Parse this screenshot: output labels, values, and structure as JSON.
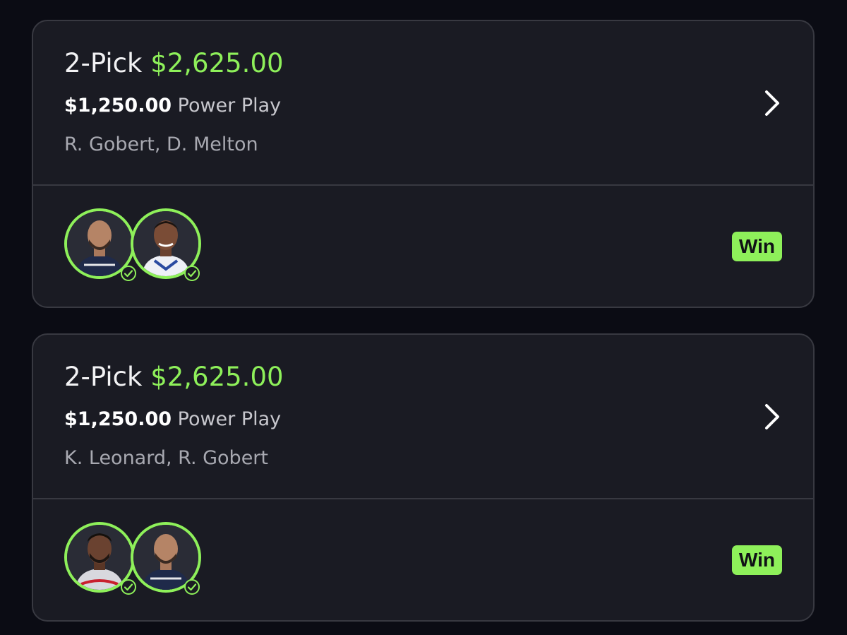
{
  "colors": {
    "background": "#0b0c14",
    "card": "#1a1b23",
    "accent_green": "#8ef05a",
    "border": "#383941"
  },
  "entries": [
    {
      "pick_label": "2-Pick",
      "payout": "$2,625.00",
      "entry_amount": "$1,250.00",
      "play_type": "Power Play",
      "players": "R. Gobert, D. Melton",
      "result": "Win",
      "avatars": [
        {
          "player": "R. Gobert",
          "status": "check-icon"
        },
        {
          "player": "D. Melton",
          "status": "check-icon"
        }
      ]
    },
    {
      "pick_label": "2-Pick",
      "payout": "$2,625.00",
      "entry_amount": "$1,250.00",
      "play_type": "Power Play",
      "players": "K. Leonard, R. Gobert",
      "result": "Win",
      "avatars": [
        {
          "player": "K. Leonard",
          "status": "check-icon"
        },
        {
          "player": "R. Gobert",
          "status": "check-icon"
        }
      ]
    }
  ]
}
